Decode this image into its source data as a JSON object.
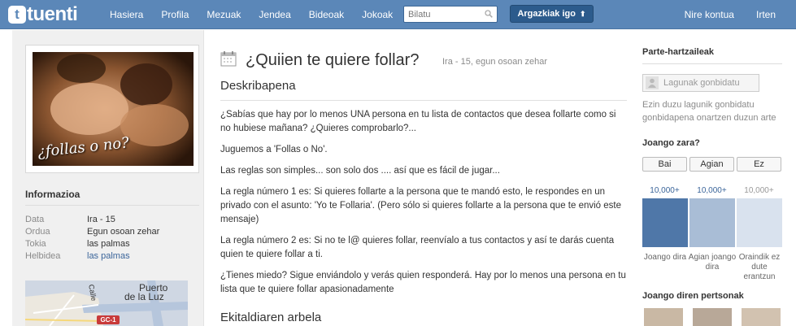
{
  "app": {
    "logo_text": "tuenti",
    "logo_mark": "t"
  },
  "nav": {
    "items": [
      "Hasiera",
      "Profila",
      "Mezuak",
      "Jendea",
      "Bideoak",
      "Jokoak"
    ],
    "search_placeholder": "Bilatu",
    "upload_label": "Argazkiak igo",
    "account_label": "Nire kontua",
    "logout_label": "Irten"
  },
  "photo": {
    "caption": "¿follas o no?"
  },
  "info": {
    "title": "Informazioa",
    "rows": [
      {
        "key": "Data",
        "value": "Ira - 15"
      },
      {
        "key": "Ordua",
        "value": "Egun osoan zehar"
      },
      {
        "key": "Tokia",
        "value": "las palmas"
      },
      {
        "key": "Helbidea",
        "value": "las palmas"
      }
    ]
  },
  "map": {
    "label1": "Puerto",
    "label2": "de la Luz",
    "road": "GC-1",
    "street": "Calle"
  },
  "event": {
    "title": "¿Quiien te quiere follar?",
    "date": "Ira - 15, egun osoan zehar",
    "description_heading": "Deskribapena",
    "paragraphs": [
      "¿Sabías que hay por lo menos UNA persona en tu lista de contactos que desea follarte como si no hubiese mañana? ¿Quieres comprobarlo?...",
      "Juguemos a 'Follas o No'.",
      "Las reglas son simples... son solo dos .... así que es fácil de jugar...",
      "La regla número 1 es: Si quieres follarte a la persona que te mandó esto, le respondes en un privado con el asunto: 'Yo te Follaria'. (Pero sólo si quieres follarte a la persona que te envió este mensaje)",
      "La regla número 2 es: Si no te l@ quieres follar, reenvíalo a tus contactos y así te darás cuenta quien te quiere follar a ti.",
      "¿Tienes miedo? Sigue enviándolo y verás quien responderá. Hay por lo menos una persona en tu lista que te quiere follar apasionadamente"
    ],
    "wall_heading": "Ekitaldiaren arbela"
  },
  "sidebar": {
    "participants_title": "Parte-hartzaileak",
    "invite_label": "Lagunak gonbidatu",
    "invite_note": "Ezin duzu lagunik gonbidatu gonbidapena onartzen duzun arte",
    "going_title": "Joango zara?",
    "rsvp": [
      "Bai",
      "Agian",
      "Ez"
    ],
    "stats": [
      {
        "count": "10,000+",
        "label": "Joango dira",
        "color": "#4f77a8",
        "count_color": "#3b659a"
      },
      {
        "count": "10,000+",
        "label": "Agian joango dira",
        "color": "#a9bdd6",
        "count_color": "#3b659a"
      },
      {
        "count": "10,000+",
        "label": "Oraindik ez dute erantzun",
        "color": "#d9e2ee",
        "count_color": "#999999"
      }
    ],
    "people_title": "Joango diren pertsonak"
  }
}
